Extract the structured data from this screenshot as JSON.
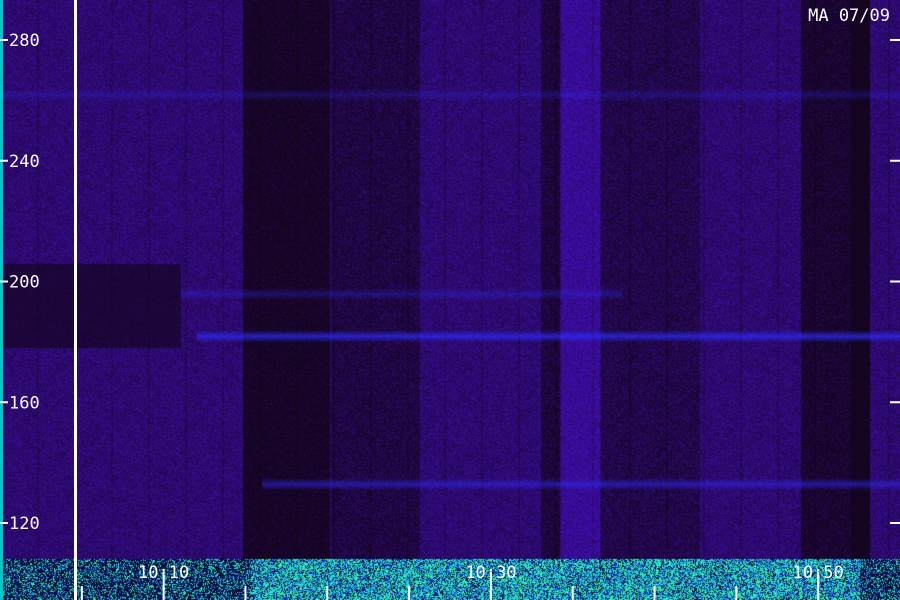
{
  "station_label": "MA 07/09",
  "colors": {
    "background": "#180828",
    "band_blue": "#2c2cff",
    "low_noise_green": "#30ff90",
    "low_noise_cyan": "#18c8e8",
    "left_edge": "#00c8c8",
    "axis": "#ffffff"
  },
  "chart_data": {
    "type": "heatmap",
    "title": "",
    "xlabel": "",
    "ylabel": "",
    "x_tick_labels": [
      "10:10",
      "10:30",
      "10:50"
    ],
    "y_tick_labels": [
      "120",
      "160",
      "200",
      "240",
      "280"
    ],
    "y_ticks": [
      120,
      160,
      200,
      240,
      280
    ],
    "ylim": [
      106,
      292
    ],
    "xlim_minutes": [
      0,
      55
    ],
    "x_label_minutes": [
      10,
      30,
      50
    ],
    "colormap": [
      "#000000",
      "#180828",
      "#3a10a0",
      "#2c2cff",
      "#18c8e8",
      "#30ff90"
    ],
    "features": [
      {
        "kind": "horizontal-band",
        "y": 182,
        "x_start_minutes": 12,
        "x_end_minutes": 55,
        "intensity": 0.85
      },
      {
        "kind": "horizontal-band",
        "y": 133,
        "x_start_minutes": 16,
        "x_end_minutes": 55,
        "intensity": 0.6
      },
      {
        "kind": "horizontal-band",
        "y": 196,
        "x_start_minutes": 11,
        "x_end_minutes": 38,
        "intensity": 0.35
      },
      {
        "kind": "horizontal-band",
        "y": 262,
        "x_start_minutes": 0,
        "x_end_minutes": 55,
        "intensity": 0.3
      },
      {
        "kind": "dark-region",
        "y_from": 178,
        "y_to": 206,
        "x_start_minutes": 0,
        "x_end_minutes": 11,
        "intensity": 0.0
      },
      {
        "kind": "low-frequency-noise",
        "y_from": 106,
        "y_to": 111,
        "x_start_minutes": 0,
        "x_end_minutes": 55,
        "intensity": 0.9
      }
    ]
  }
}
